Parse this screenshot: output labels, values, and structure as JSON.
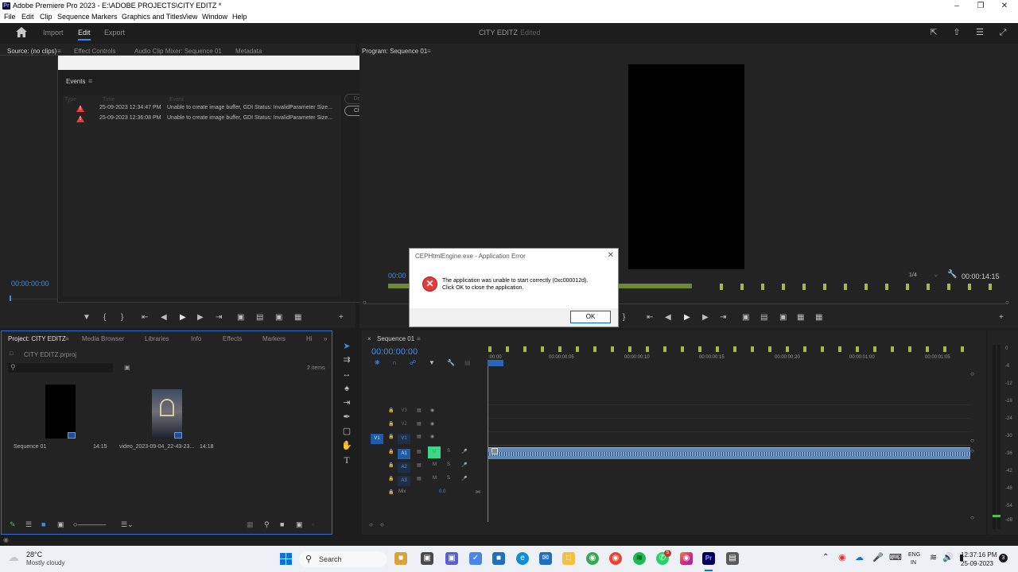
{
  "window": {
    "title": "Adobe Premiere Pro 2023 - E:\\ADOBE PROJECTS\\CITY EDITZ *",
    "app_badge": "Pr"
  },
  "menu": [
    "File",
    "Edit",
    "Clip",
    "Sequence",
    "Markers",
    "Graphics and Titles",
    "View",
    "Window",
    "Help"
  ],
  "header": {
    "tabs": [
      "Import",
      "Edit",
      "Export"
    ],
    "active_tab": "Edit",
    "project_name": "CITY EDITZ",
    "status": "Edited"
  },
  "source_panel": {
    "tabs": [
      "Source: (no clips)",
      "Effect Controls",
      "Audio Clip Mixer: Sequence 01",
      "Metadata"
    ],
    "timecode": "00:00:00:00"
  },
  "events": {
    "title": "Events",
    "columns": [
      "Type",
      "Time",
      "Event"
    ],
    "rows": [
      {
        "time": "25-09-2023 12:34:47 PM",
        "message": "Unable to create image buffer, GDI Status: InvalidParameter Size..."
      },
      {
        "time": "25-09-2023 12:36:08 PM",
        "message": "Unable to create image buffer, GDI Status: InvalidParameter Size..."
      }
    ],
    "details_label": "Details...",
    "clear_all_label": "Clear All"
  },
  "program": {
    "tab": "Program: Sequence 01",
    "timecode_left": "00:00",
    "resolution": "1/4",
    "duration": "00:00:14:15"
  },
  "error_dialog": {
    "title": "CEPHtmlEngine.exe - Application Error",
    "line1": "The application was unable to start correctly (0xc000012d).",
    "line2": "Click OK to close the application.",
    "ok_label": "OK"
  },
  "project_panel": {
    "tabs": [
      "Project: CITY EDITZ",
      "Media Browser",
      "Libraries",
      "Info",
      "Effects",
      "Markers",
      "Hi"
    ],
    "file": "CITY EDITZ.prproj",
    "item_count": "2 items",
    "items": [
      {
        "name": "Sequence 01",
        "duration": "14:15"
      },
      {
        "name": "video_2023-09-04_22-43-23...",
        "duration": "14:18"
      }
    ]
  },
  "timeline": {
    "tab": "Sequence 01",
    "timecode": "00:00:00:00",
    "ruler": [
      ":00:00",
      "00:00:00:05",
      "00:00:00:10",
      "00:00:00:15",
      "00:00:00:20",
      "00:00:01:00",
      "00:00:01:05"
    ],
    "video_tracks": [
      "V3",
      "V2",
      "V1"
    ],
    "audio_tracks": [
      "A1",
      "A2",
      "A3"
    ],
    "source_patch_v": "V1",
    "mix_label": "Mix",
    "mix_value": "0.0",
    "track_m": "M",
    "track_s": "S"
  },
  "meters": {
    "scale": [
      "0",
      "-6",
      "-12",
      "-18",
      "-24",
      "-30",
      "-36",
      "-42",
      "-48",
      "-54",
      "-dB"
    ]
  },
  "taskbar": {
    "weather_temp": "28°C",
    "weather_desc": "Mostly cloudy",
    "search_label": "Search",
    "lang_top": "ENG",
    "lang_bottom": "IN",
    "time": "12:37:16 PM",
    "date": "25-09-2023",
    "notif_count": "3",
    "badge_count": "5"
  }
}
